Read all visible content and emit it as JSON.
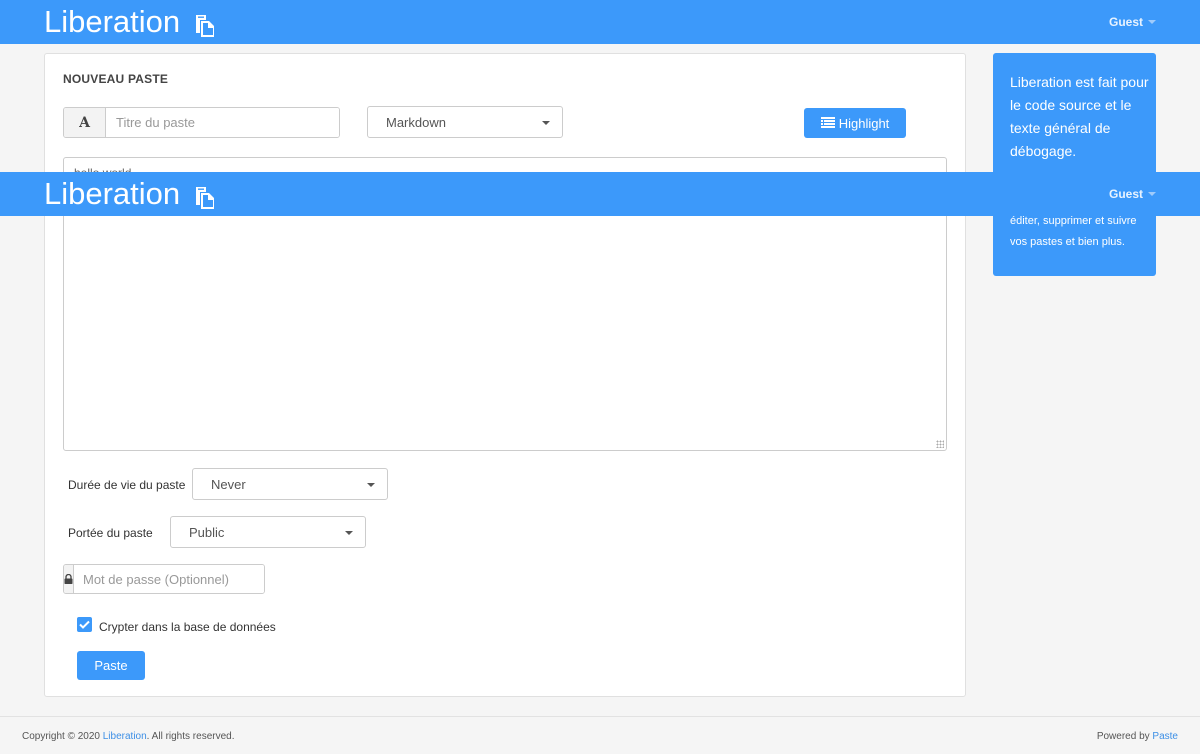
{
  "navbar": {
    "brand": "Liberation",
    "brand_icon": "paste-icon",
    "user_menu_label": "Guest"
  },
  "form": {
    "title": "NOUVEAU PASTE",
    "title_input": {
      "addon": "A",
      "placeholder": "Titre du paste",
      "value": ""
    },
    "syntax_select": {
      "selected": "Markdown"
    },
    "highlight_button": {
      "label": "Highlight",
      "icon": "list-icon"
    },
    "content_textarea": {
      "value": "hello world"
    },
    "expiration": {
      "label": "Durée de vie du paste",
      "selected": "Never"
    },
    "visibility": {
      "label": "Portée du paste",
      "selected": "Public"
    },
    "password_input": {
      "icon": "lock-icon",
      "placeholder": "Mot de passe (Optionnel)",
      "value": ""
    },
    "encrypt_checkbox": {
      "label": "Crypter dans la base de données",
      "checked": true
    },
    "submit_button": {
      "label": "Paste"
    }
  },
  "sidebar": {
    "main_text": "Liberation est fait pour le code source et le texte général de débogage.",
    "sub_text": "éditer, supprimer et suivre vos pastes et bien plus."
  },
  "footer": {
    "copyright_prefix": "Copyright © 2020 ",
    "copyright_link": "Liberation",
    "copyright_suffix": ". All rights reserved.",
    "powered_prefix": "Powered by ",
    "powered_link": "Paste"
  },
  "colors": {
    "accent": "#3c99fa",
    "background": "#f5f5f5",
    "link": "#3c8fe6"
  }
}
